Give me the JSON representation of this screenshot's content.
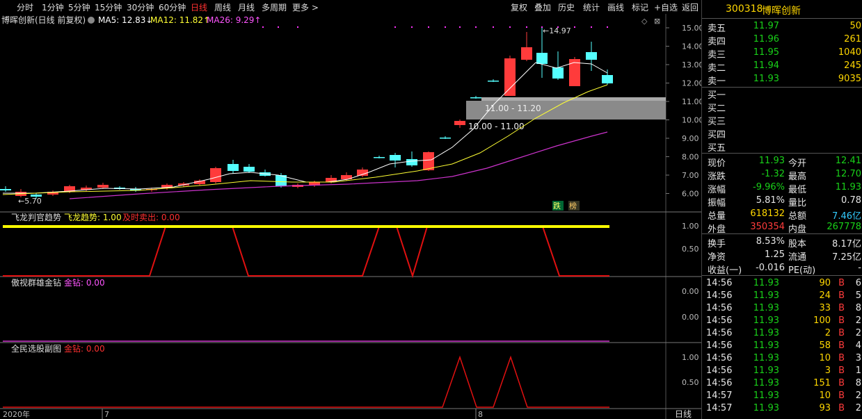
{
  "toolbar": {
    "left": [
      "分时",
      "1分钟",
      "5分钟",
      "15分钟",
      "30分钟",
      "60分钟",
      "日线",
      "周线",
      "月线",
      "多周期",
      "更多 >"
    ],
    "active": "日线",
    "right": [
      "复权",
      "叠加",
      "历史",
      "统计",
      "画线",
      "标记",
      "+自选",
      "返回"
    ]
  },
  "chart": {
    "title": "博晖创新(日线 前复权)",
    "ma5": "MA5: 12.83↓",
    "ma12": "MA12: 11.82↑",
    "ma26": "MA26: 9.29↑",
    "price_axis": [
      "15.00",
      "14.00",
      "13.00",
      "12.00",
      "11.00",
      "10.00",
      "9.00",
      "8.00",
      "7.00",
      "6.00"
    ],
    "high_label": "14.97",
    "low_label": "5.70",
    "zone1_label": "11.00 - 11.20",
    "zone2_label": "10.00 - 11.00",
    "tag_die": "跌",
    "tag_bang": "榜",
    "last_price_marker": "12.00"
  },
  "sub1": {
    "title": "飞龙判官趋势",
    "s1": "飞龙趋势: 1.00",
    "s2": "及时卖出: 0.00",
    "axis": [
      "1.00",
      "0.50"
    ]
  },
  "sub2": {
    "title": "傲视群雄金钻",
    "s1": "金钻: 0.00",
    "axis": [
      "0.00",
      "0.00"
    ]
  },
  "sub3": {
    "title": "全民选股副图",
    "s1": "金钻: 0.00",
    "axis": [
      "1.00",
      "0.50"
    ]
  },
  "xaxis": {
    "labels": [
      "2020年",
      "7",
      "8"
    ],
    "period": "日线"
  },
  "colors": {
    "up": "#ff3b3b",
    "down": "#54ffff",
    "ma5": "#ffffff",
    "ma12": "#ffff33",
    "ma26": "#cc33cc",
    "accent": "#ffd700"
  },
  "quote": {
    "code": "300318",
    "name": "博晖创新",
    "asks": [
      {
        "label": "卖五",
        "price": "11.97",
        "vol": "50"
      },
      {
        "label": "卖四",
        "price": "11.96",
        "vol": "261"
      },
      {
        "label": "卖三",
        "price": "11.95",
        "vol": "1040"
      },
      {
        "label": "卖二",
        "price": "11.94",
        "vol": "245"
      },
      {
        "label": "卖一",
        "price": "11.93",
        "vol": "9035"
      }
    ],
    "bids": [
      "买一",
      "买二",
      "买三",
      "买四",
      "买五"
    ],
    "stats": [
      {
        "k1": "现价",
        "v1": "11.93",
        "k2": "今开",
        "v2": "12.41"
      },
      {
        "k1": "涨跌",
        "v1": "-1.32",
        "k2": "最高",
        "v2": "12.70"
      },
      {
        "k1": "涨幅",
        "v1": "-9.96%",
        "k2": "最低",
        "v2": "11.93"
      },
      {
        "k1": "振幅",
        "v1": "5.81%",
        "k2": "量比",
        "v2": "0.78"
      },
      {
        "k1": "总量",
        "v1": "618132",
        "k2": "总额",
        "v2": "7.46亿"
      },
      {
        "k1": "外盘",
        "v1": "350354",
        "k2": "内盘",
        "v2": "267778"
      }
    ],
    "stats2": [
      {
        "k1": "换手",
        "v1": "8.53%",
        "k2": "股本",
        "v2": "8.17亿"
      },
      {
        "k1": "净资",
        "v1": "1.25",
        "k2": "流通",
        "v2": "7.25亿"
      },
      {
        "k1": "收益(一)",
        "v1": "-0.016",
        "k2": "PE(动)",
        "v2": "-"
      }
    ],
    "ticks": [
      {
        "t": "14:56",
        "p": "11.93",
        "v": "90",
        "d": "B",
        "n": "6"
      },
      {
        "t": "14:56",
        "p": "11.93",
        "v": "24",
        "d": "B",
        "n": "5"
      },
      {
        "t": "14:56",
        "p": "11.93",
        "v": "33",
        "d": "B",
        "n": "8"
      },
      {
        "t": "14:56",
        "p": "11.93",
        "v": "100",
        "d": "B",
        "n": "2"
      },
      {
        "t": "14:56",
        "p": "11.93",
        "v": "2",
        "d": "B",
        "n": "2"
      },
      {
        "t": "14:56",
        "p": "11.93",
        "v": "58",
        "d": "B",
        "n": "4"
      },
      {
        "t": "14:56",
        "p": "11.93",
        "v": "10",
        "d": "B",
        "n": "3"
      },
      {
        "t": "14:56",
        "p": "11.93",
        "v": "3",
        "d": "B",
        "n": "1"
      },
      {
        "t": "14:56",
        "p": "11.93",
        "v": "151",
        "d": "B",
        "n": "8"
      },
      {
        "t": "14:57",
        "p": "11.93",
        "v": "10",
        "d": "B",
        "n": "2"
      },
      {
        "t": "14:57",
        "p": "11.93",
        "v": "93",
        "d": "B",
        "n": "2"
      }
    ]
  }
}
